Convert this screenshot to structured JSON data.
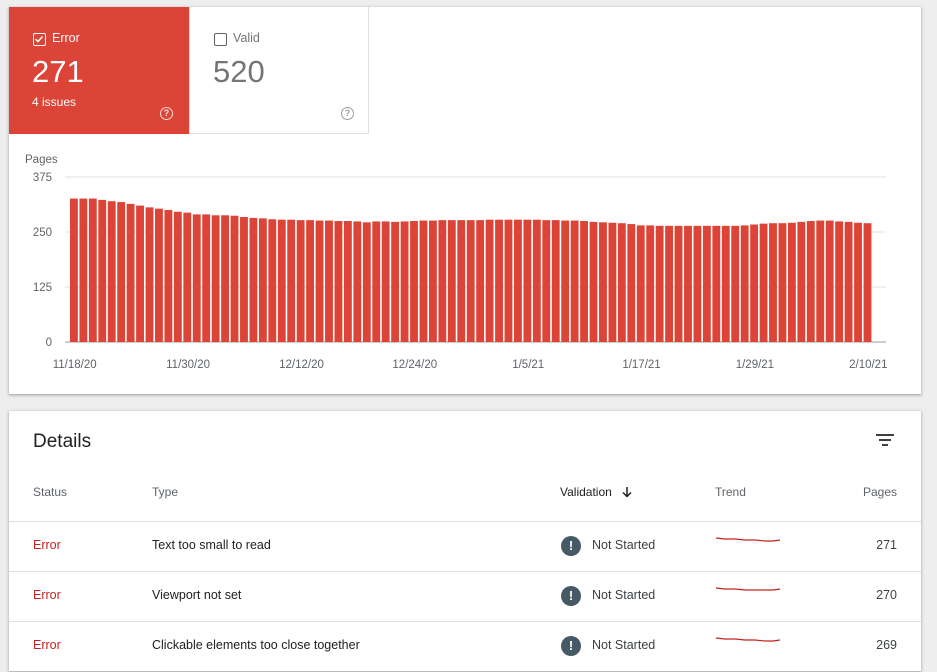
{
  "tiles": {
    "error": {
      "label": "Error",
      "count": "271",
      "sub": "4 issues",
      "checked": true
    },
    "valid": {
      "label": "Valid",
      "count": "520",
      "checked": false
    }
  },
  "colors": {
    "error": "#db4437",
    "error_text": "#c5221f",
    "grid": "#e0e0e0",
    "validation_icon": "#455a64"
  },
  "chart_data": {
    "type": "bar",
    "ylabel": "Pages",
    "ylim": [
      0,
      375
    ],
    "yticks": [
      "0",
      "125",
      "250",
      "375"
    ],
    "xticks": [
      "11/18/20",
      "11/30/20",
      "12/12/20",
      "12/24/20",
      "1/5/21",
      "1/17/21",
      "1/29/21",
      "2/10/21"
    ],
    "values": [
      326,
      326,
      326,
      323,
      320,
      318,
      314,
      310,
      306,
      303,
      300,
      296,
      294,
      290,
      290,
      288,
      288,
      287,
      284,
      282,
      281,
      279,
      278,
      278,
      277,
      277,
      276,
      276,
      275,
      275,
      274,
      272,
      274,
      274,
      273,
      274,
      275,
      276,
      276,
      277,
      277,
      277,
      277,
      277,
      278,
      278,
      278,
      278,
      278,
      278,
      277,
      277,
      276,
      276,
      275,
      273,
      272,
      271,
      270,
      268,
      265,
      265,
      264,
      264,
      264,
      264,
      264,
      264,
      264,
      264,
      264,
      265,
      267,
      269,
      270,
      270,
      271,
      273,
      275,
      276,
      276,
      274,
      273,
      271,
      270
    ],
    "grid": true
  },
  "details": {
    "title": "Details",
    "columns": {
      "status": "Status",
      "type": "Type",
      "validation": "Validation",
      "trend": "Trend",
      "pages": "Pages"
    },
    "rows": [
      {
        "status": "Error",
        "type": "Text too small to read",
        "validation": "Not Started",
        "pages": "271"
      },
      {
        "status": "Error",
        "type": "Viewport not set",
        "validation": "Not Started",
        "pages": "270"
      },
      {
        "status": "Error",
        "type": "Clickable elements too close together",
        "validation": "Not Started",
        "pages": "269"
      }
    ]
  },
  "icons": {
    "filter": "filter-icon",
    "sort": "arrow-down-icon",
    "help": "help-circle-icon",
    "validation": "exclamation-circle-icon"
  }
}
